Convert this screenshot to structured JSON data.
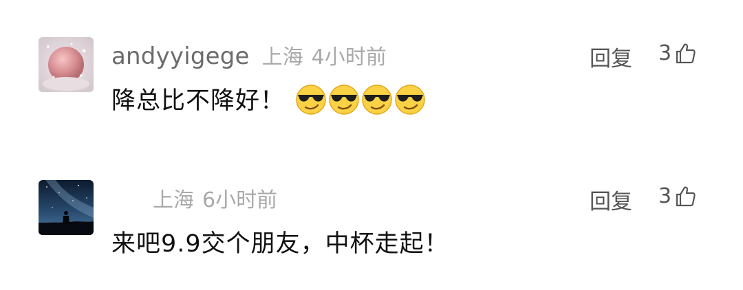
{
  "comments": [
    {
      "username": "andyyigege",
      "location": "上海",
      "time": "4小时前",
      "reply_label": "回复",
      "likes": "3",
      "text": "降总比不降好！",
      "emojis": [
        "cool-sunglasses",
        "cool-sunglasses",
        "cool-sunglasses",
        "cool-sunglasses"
      ]
    },
    {
      "username": "",
      "location": "上海",
      "time": "6小时前",
      "reply_label": "回复",
      "likes": "3",
      "text": "来吧9.9交个朋友，中杯走起！"
    }
  ],
  "colors": {
    "username": "#6b6b6b",
    "meta": "#a9a9a9",
    "text": "#111111",
    "action": "#555555"
  }
}
